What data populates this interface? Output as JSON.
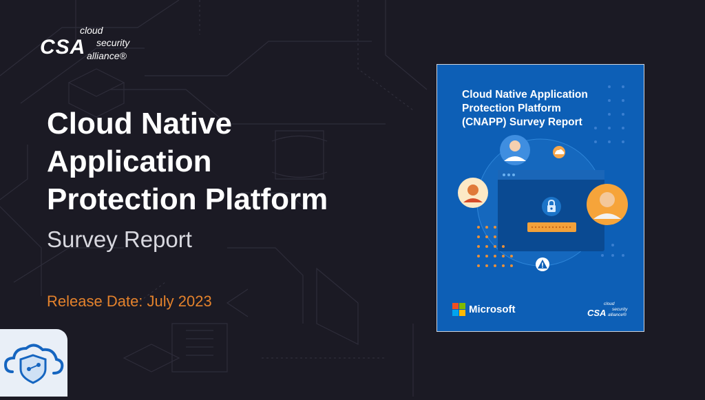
{
  "brand": {
    "mark": "CSA",
    "words": [
      "cloud",
      "security",
      "alliance®"
    ]
  },
  "title_lines": [
    "Cloud Native",
    "Application",
    "Protection Platform"
  ],
  "subtitle": "Survey Report",
  "release": "Release Date: July 2023",
  "report_cover": {
    "title_lines": [
      "Cloud Native Application",
      "Protection Platform",
      "(CNAPP) Survey Report"
    ],
    "sponsor": "Microsoft",
    "brand_mark": "CSA",
    "brand_words": [
      "cloud",
      "security",
      "alliance®"
    ]
  },
  "colors": {
    "background": "#1b1a24",
    "accent": "#e4822c",
    "cover_blue": "#0d5fb6"
  },
  "icons": [
    "cloud-shield-icon",
    "lock-icon",
    "warning-icon",
    "microsoft-logo-icon"
  ]
}
